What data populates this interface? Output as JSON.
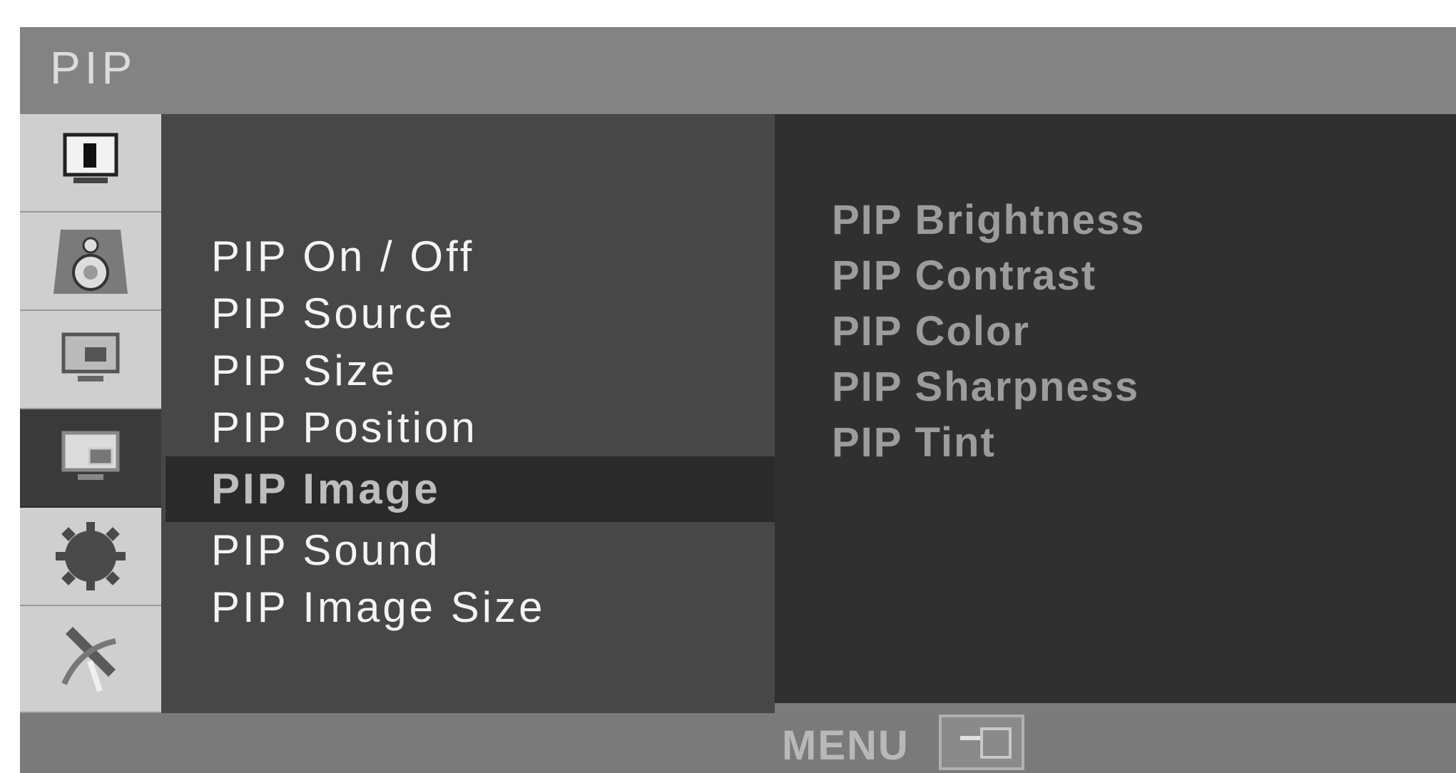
{
  "window": {
    "title": "PIP"
  },
  "tabs": [
    {
      "icon": "picture-icon",
      "active": false
    },
    {
      "icon": "speaker-icon",
      "active": false
    },
    {
      "icon": "monitor-icon",
      "active": false
    },
    {
      "icon": "pip-icon",
      "active": true
    },
    {
      "icon": "gear-icon",
      "active": false
    },
    {
      "icon": "satellite-dish-icon",
      "active": false
    }
  ],
  "menu": {
    "items": [
      {
        "label": "PIP On / Off"
      },
      {
        "label": "PIP Source"
      },
      {
        "label": "PIP Size"
      },
      {
        "label": "PIP Position"
      },
      {
        "label": "PIP Image",
        "selected": true
      },
      {
        "label": "PIP Sound"
      },
      {
        "label": "PIP Image Size"
      }
    ]
  },
  "submenu": {
    "items": [
      {
        "label": "PIP Brightness"
      },
      {
        "label": "PIP Contrast"
      },
      {
        "label": "PIP Color"
      },
      {
        "label": "PIP Sharpness"
      },
      {
        "label": "PIP Tint"
      }
    ]
  },
  "footer": {
    "menu_label": "MENU"
  },
  "colors": {
    "selected_bg": "#2a2a2a",
    "panel_bg": "#474747",
    "submenu_bg": "#303030"
  }
}
